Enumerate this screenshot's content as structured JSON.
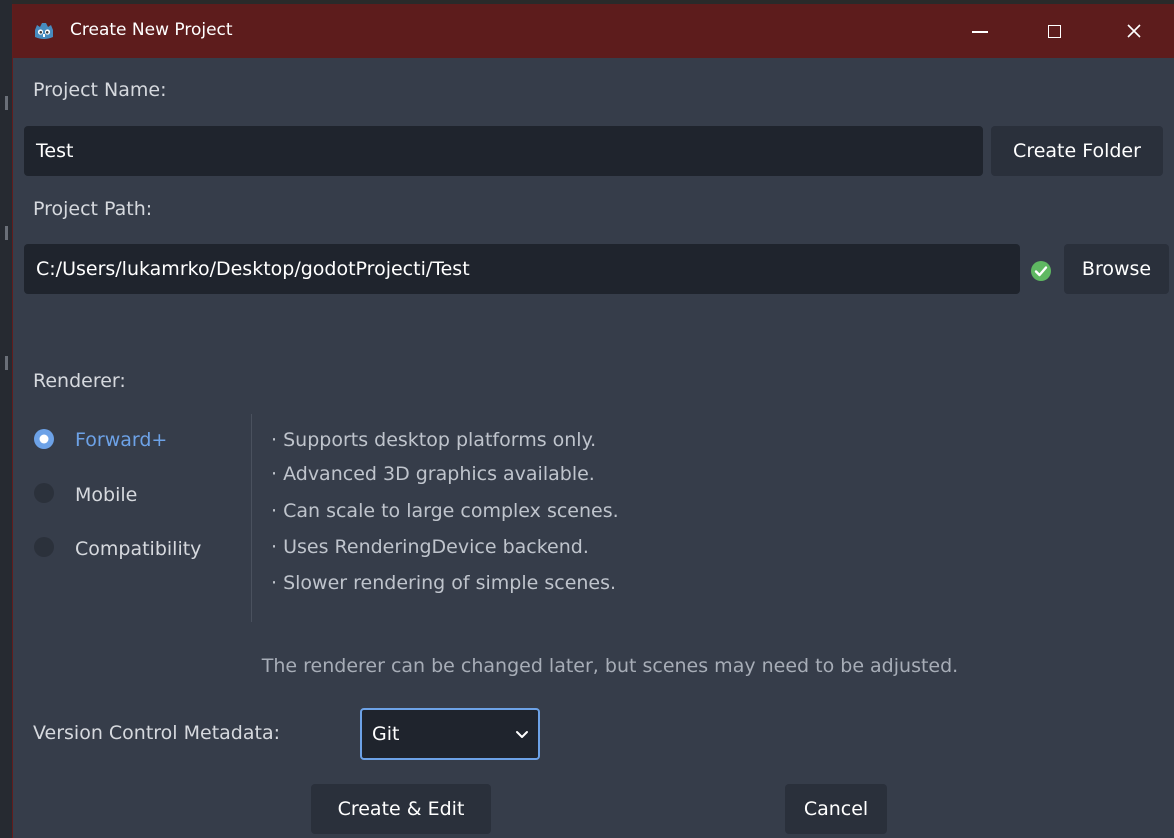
{
  "window": {
    "title": "Create New Project",
    "titlebar_color": "#5d1c1c",
    "background_color": "#363d4a",
    "controls": [
      "minimize-icon",
      "maximize-icon",
      "close-icon"
    ]
  },
  "project_name": {
    "label": "Project Name:",
    "value": "Test",
    "create_folder_label": "Create Folder"
  },
  "project_path": {
    "label": "Project Path:",
    "value": "C:/Users/lukamrko/Desktop/godotProjecti/Test",
    "status_icon": "check-circle-icon",
    "status_color": "#5fb862",
    "browse_label": "Browse"
  },
  "renderer": {
    "label": "Renderer:",
    "options": [
      {
        "label": "Forward+",
        "selected": true
      },
      {
        "label": "Mobile",
        "selected": false
      },
      {
        "label": "Compatibility",
        "selected": false
      }
    ],
    "selected_color": "#6da2e7",
    "description": [
      "Supports desktop platforms only.",
      "Advanced 3D graphics available.",
      "Can scale to large complex scenes.",
      "Uses RenderingDevice backend.",
      "Slower rendering of simple scenes."
    ],
    "note": "The renderer can be changed later, but scenes may need to be adjusted."
  },
  "version_control": {
    "label": "Version Control Metadata:",
    "selected": "Git"
  },
  "actions": {
    "create_label": "Create & Edit",
    "cancel_label": "Cancel"
  }
}
